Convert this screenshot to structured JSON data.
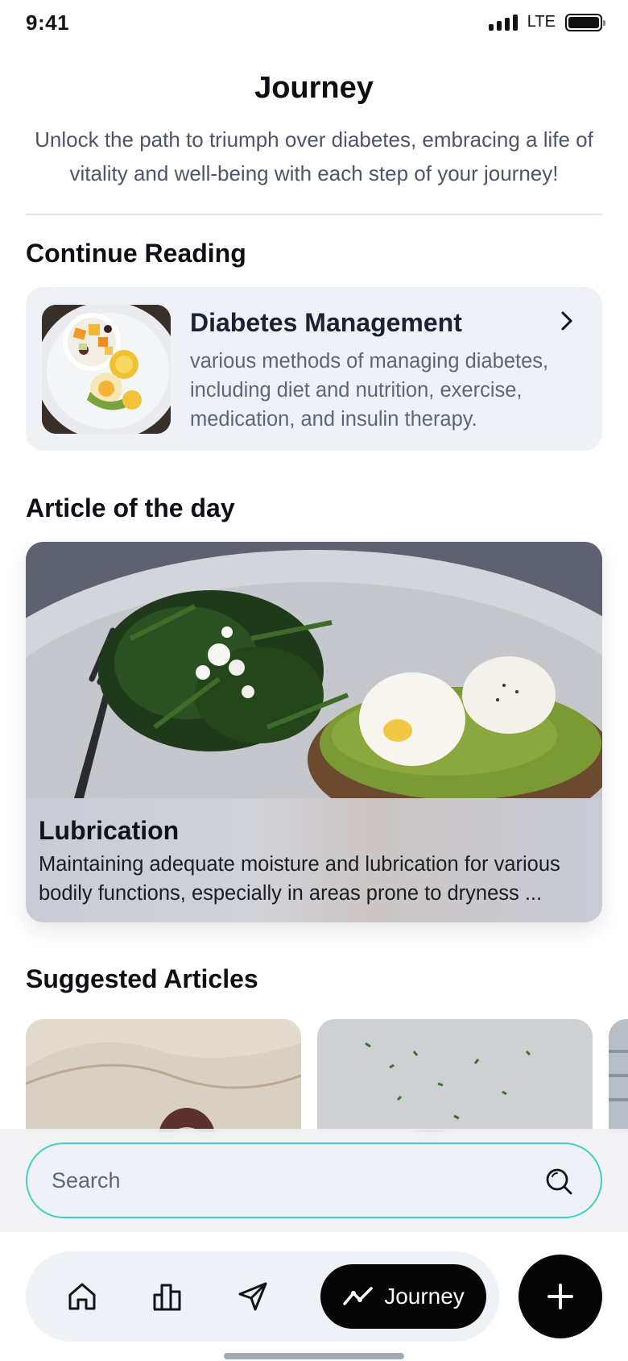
{
  "status_bar": {
    "time": "9:41",
    "network": "LTE"
  },
  "header": {
    "title": "Journey",
    "subtitle": "Unlock the path to triumph over diabetes, embracing a life of vitality and well-being with each step of your journey!"
  },
  "continue_reading": {
    "section_title": "Continue Reading",
    "card": {
      "title": "Diabetes Management",
      "description": "various methods of managing diabetes, including diet and nutrition, exercise, medication, and insulin therapy."
    }
  },
  "article_of_day": {
    "section_title": "Article of the day",
    "title": "Lubrication",
    "description": "Maintaining adequate moisture and lubrication for various bodily functions, especially in areas prone to dryness ..."
  },
  "suggested": {
    "section_title": "Suggested Articles"
  },
  "search": {
    "placeholder": "Search"
  },
  "nav": {
    "active_label": "Journey",
    "items": [
      "home-icon",
      "chart-icon",
      "send-icon",
      "journey-icon"
    ]
  },
  "colors": {
    "accent": "#3fcfc3",
    "card_bg": "#eef1f6",
    "active_nav": "#050505"
  }
}
